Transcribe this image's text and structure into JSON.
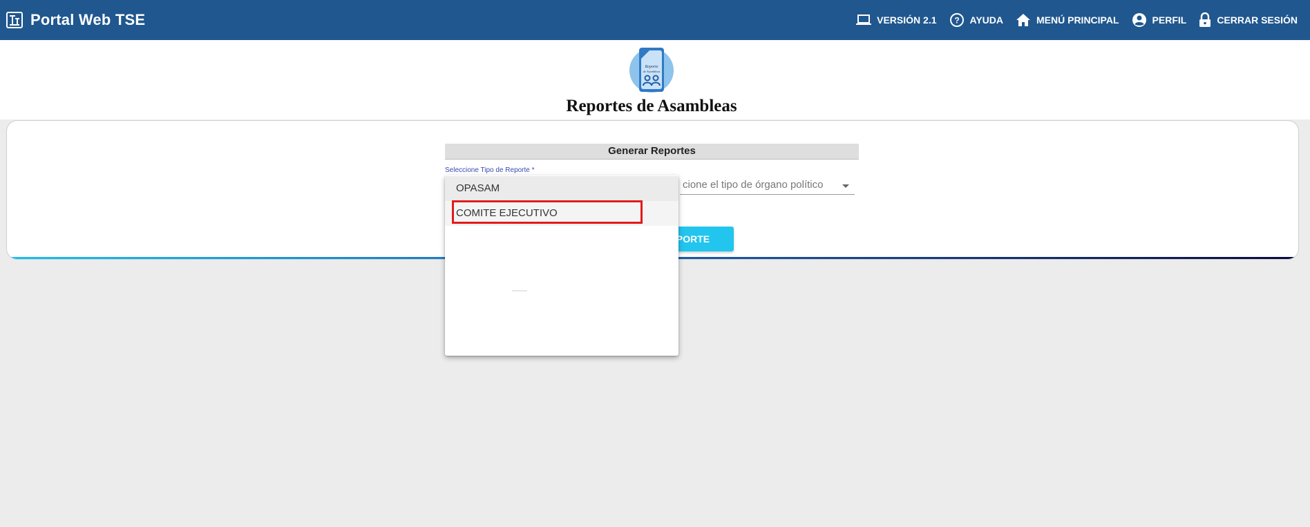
{
  "app": {
    "title": "Portal Web TSE"
  },
  "nav": {
    "items": [
      {
        "label": "VERSIÓN 2.1",
        "icon": "laptop-icon"
      },
      {
        "label": "AYUDA",
        "icon": "help-icon"
      },
      {
        "label": "MENÚ PRINCIPAL",
        "icon": "home-icon"
      },
      {
        "label": "PERFIL",
        "icon": "account-icon"
      },
      {
        "label": "CERRAR SESIÓN",
        "icon": "lock-icon"
      }
    ]
  },
  "page": {
    "title": "Reportes de Asambleas",
    "icon": "report-assemblies-icon"
  },
  "form": {
    "section_title": "Generar Reportes",
    "report_type_label": "Seleccione Tipo de Reporte *",
    "organ_select_text": "cione el tipo de órgano político",
    "generate_button": "PORTE"
  },
  "dropdown": {
    "options": [
      "OPASAM",
      "COMITE EJECUTIVO"
    ],
    "highlighted": "COMITE EJECUTIVO"
  },
  "colors": {
    "topbar": "#20578f",
    "button": "#22c5ee",
    "highlight_border": "#e21b1b"
  }
}
